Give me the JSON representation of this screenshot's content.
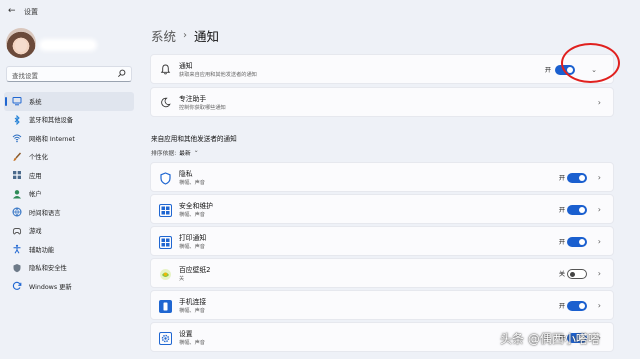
{
  "window": {
    "title": "设置"
  },
  "sidebar": {
    "search_placeholder": "查找设置",
    "items": [
      {
        "label": "系统",
        "icon": "monitor-icon",
        "active": true
      },
      {
        "label": "蓝牙和其他设备",
        "icon": "bluetooth-icon"
      },
      {
        "label": "网络和 Internet",
        "icon": "network-icon"
      },
      {
        "label": "个性化",
        "icon": "brush-icon"
      },
      {
        "label": "应用",
        "icon": "apps-icon"
      },
      {
        "label": "帐户",
        "icon": "account-icon"
      },
      {
        "label": "时间和语言",
        "icon": "globe-clock-icon"
      },
      {
        "label": "游戏",
        "icon": "gamepad-icon"
      },
      {
        "label": "辅助功能",
        "icon": "accessibility-icon"
      },
      {
        "label": "隐私和安全性",
        "icon": "shield-icon"
      },
      {
        "label": "Windows 更新",
        "icon": "update-icon"
      }
    ]
  },
  "main": {
    "breadcrumb_parent": "系统",
    "breadcrumb_current": "通知",
    "notifications": {
      "title": "通知",
      "subtitle": "获取来自应用和其他发送者的通知",
      "toggle_label": "开",
      "enabled": true
    },
    "focus_assist": {
      "title": "专注助手",
      "subtitle": "控制你获取哪些通知"
    },
    "section_title": "来自应用和其他发送者的通知",
    "sort_label": "排序依据:",
    "sort_value": "最新",
    "apps": [
      {
        "name": "隐私",
        "sub": "横幅、声音",
        "toggle_label": "开",
        "enabled": true,
        "icon": "privacy-shield-icon"
      },
      {
        "name": "安全和维护",
        "sub": "横幅、声音",
        "toggle_label": "开",
        "enabled": true,
        "icon": "security-maintenance-icon"
      },
      {
        "name": "打印通知",
        "sub": "横幅、声音",
        "toggle_label": "开",
        "enabled": true,
        "icon": "print-notification-icon"
      },
      {
        "name": "百应壁纸2",
        "sub": "关",
        "toggle_label": "关",
        "enabled": false,
        "icon": "wallpaper-app-icon"
      },
      {
        "name": "手机连接",
        "sub": "横幅、声音",
        "toggle_label": "开",
        "enabled": true,
        "icon": "phone-link-icon"
      },
      {
        "name": "设置",
        "sub": "横幅、声音",
        "toggle_label": "开",
        "enabled": true,
        "icon": "settings-gear-icon"
      }
    ]
  },
  "watermark": "头条 @偶西小嗒嗒",
  "colors": {
    "accent": "#1a5fcf",
    "annotation": "#e0201e"
  }
}
